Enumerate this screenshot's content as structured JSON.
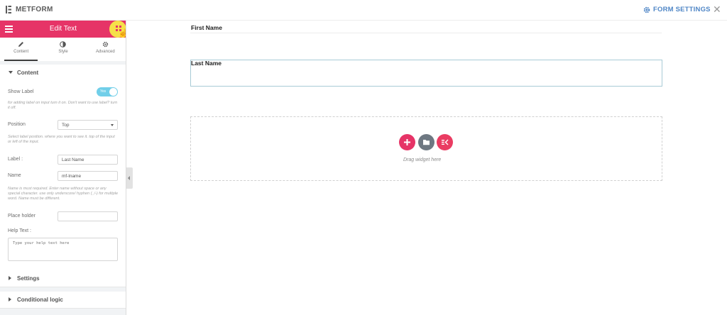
{
  "topbar": {
    "brand": "METFORM",
    "form_settings_label": "FORM SETTINGS"
  },
  "panel": {
    "title": "Edit Text",
    "tabs": [
      {
        "label": "Content",
        "icon": "pencil-icon"
      },
      {
        "label": "Style",
        "icon": "half-circle-icon"
      },
      {
        "label": "Advanced",
        "icon": "gear-icon"
      }
    ],
    "content_section": "Content",
    "show_label": {
      "label": "Show Label",
      "toggle_text": "Yes",
      "state": true,
      "description": "for adding label on input turn it on. Don't want to use label? turn it off."
    },
    "position": {
      "label": "Position",
      "value": "Top",
      "description": "Select label position. where you want to see it. top of the input or left of the input."
    },
    "label_field": {
      "label": "Label :",
      "value": "Last Name"
    },
    "name_field": {
      "label": "Name",
      "value": "mf-lname",
      "description": "Name is must required. Enter name without space or any special character. use only underscore/ hyphen (_/-) for multiple word. Name must be different."
    },
    "placeholder_field": {
      "label": "Place holder",
      "value": ""
    },
    "help_text": {
      "label": "Help Text :",
      "placeholder": "Type your help text here"
    },
    "settings_section": "Settings",
    "conditional_section": "Conditional logic"
  },
  "canvas": {
    "first_name_label": "First Name",
    "last_name_label": "Last Name",
    "drag_text": "Drag widget here"
  },
  "colors": {
    "accent": "#e63467",
    "link": "#4f86c6",
    "toggle": "#71cfe9"
  }
}
